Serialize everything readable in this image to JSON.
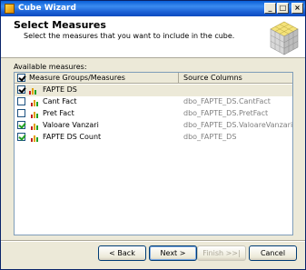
{
  "window": {
    "title": "Cube Wizard",
    "minimize_glyph": "_",
    "maximize_glyph": "□",
    "close_glyph": "×"
  },
  "header": {
    "title": "Select Measures",
    "subtitle": "Select the measures that you want to include in the cube."
  },
  "grid": {
    "available_label": "Available measures:",
    "columns": [
      "Measure Groups/Measures",
      "Source Columns"
    ],
    "rows": [
      {
        "type": "group",
        "label": "FAPTE DS",
        "source": "",
        "checked": true
      },
      {
        "type": "item",
        "label": "Cant Fact",
        "source": "dbo_FAPTE_DS.CantFact",
        "checked": false
      },
      {
        "type": "item",
        "label": "Pret Fact",
        "source": "dbo_FAPTE_DS.PretFact",
        "checked": false
      },
      {
        "type": "item",
        "label": "Valoare Vanzari",
        "source": "dbo_FAPTE_DS.ValoareVanzari",
        "checked": true
      },
      {
        "type": "item",
        "label": "FAPTE DS Count",
        "source": "dbo_FAPTE_DS",
        "checked": true
      }
    ]
  },
  "buttons": {
    "back": "< Back",
    "next": "Next >",
    "finish": "Finish >>|",
    "cancel": "Cancel"
  },
  "colors": {
    "title_bar": "#0a5fd8",
    "check": "#21a121",
    "bar_red": "#c02020",
    "bar_orange": "#e0a000",
    "bar_green": "#20a020"
  },
  "icons": {
    "measure_group": "bar-chart-icon",
    "measure": "bar-chart-icon",
    "header_graphic": "cube-icon"
  }
}
